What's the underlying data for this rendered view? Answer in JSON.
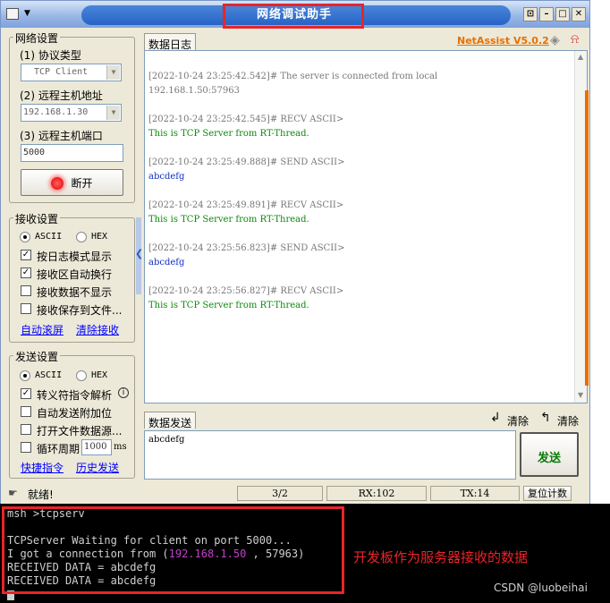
{
  "window": {
    "title": "网络调试助手"
  },
  "brand": {
    "name": "NetAssist V5.0.2"
  },
  "net_settings": {
    "group_label": "网络设置",
    "protocol_label": "(1) 协议类型",
    "protocol_value": "TCP Client",
    "host_label": "(2) 远程主机地址",
    "host_value": "192.168.1.30",
    "port_label": "(3) 远程主机端口",
    "port_value": "5000",
    "connect_button": "断开"
  },
  "recv_settings": {
    "group_label": "接收设置",
    "ascii": "ASCII",
    "hex": "HEX",
    "opt1": "按日志模式显示",
    "opt2": "接收区自动换行",
    "opt3": "接收数据不显示",
    "opt4": "接收保存到文件...",
    "auto_scroll": "自动滚屏",
    "clear_recv": "清除接收"
  },
  "send_settings": {
    "group_label": "发送设置",
    "ascii": "ASCII",
    "hex": "HEX",
    "opt1": "转义符指令解析",
    "opt2": "自动发送附加位",
    "opt3": "打开文件数据源...",
    "opt4": "循环周期",
    "period_value": "1000",
    "period_unit": "ms",
    "shortcut": "快捷指令",
    "history": "历史发送"
  },
  "log": {
    "tab_label": "数据日志",
    "lines": [
      "[2022-10-24 23:25:42.542]# The server is connected from local",
      "192.168.1.50:57963",
      "[2022-10-24 23:25:42.545]# RECV ASCII>",
      "This is TCP Server from RT-Thread.",
      "[2022-10-24 23:25:49.888]# SEND ASCII>",
      "abcdefg",
      "[2022-10-24 23:25:49.891]# RECV ASCII>",
      "This is TCP Server from RT-Thread.",
      "[2022-10-24 23:25:56.823]# SEND ASCII>",
      "abcdefg",
      "[2022-10-24 23:25:56.827]# RECV ASCII>",
      "This is TCP Server from RT-Thread."
    ]
  },
  "send_area": {
    "tab_label": "数据发送",
    "clear1": "清除",
    "clear2": "清除",
    "text": "abcdefg",
    "send_button": "发送"
  },
  "status": {
    "ready": "就绪!",
    "count": "3/2",
    "rx": "RX:102",
    "tx": "TX:14",
    "reset": "复位计数"
  },
  "terminal": {
    "lines": {
      "l1": "msh >tcpserv",
      "l2": "TCPServer Waiting for client on port 5000...",
      "l3_a": "I got a connection from (",
      "l3_ip": "192.168.1.50",
      "l3_b": " , 57963)",
      "l4": "RECEIVED DATA = abcdefg",
      "l5": "RECEIVED DATA = abcdefg"
    }
  },
  "annotation": {
    "note": "开发板作为服务器接收的数据"
  },
  "watermark": "CSDN @luobeihai"
}
